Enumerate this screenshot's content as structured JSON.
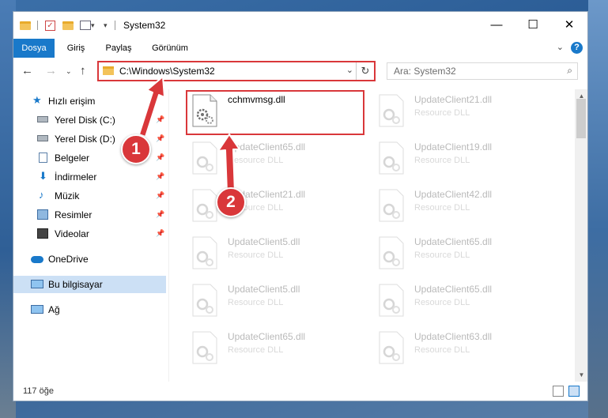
{
  "window": {
    "title": "System32"
  },
  "ribbon": {
    "tabs": [
      "Dosya",
      "Giriş",
      "Paylaş",
      "Görünüm"
    ]
  },
  "address": {
    "path": "C:\\Windows\\System32"
  },
  "search": {
    "placeholder": "Ara: System32"
  },
  "sidebar": {
    "quick_access": "Hızlı erişim",
    "items": [
      "Yerel Disk (C:)",
      "Yerel Disk (D:)",
      "Belgeler",
      "İndirmeler",
      "Müzik",
      "Resimler",
      "Videolar"
    ],
    "onedrive": "OneDrive",
    "this_pc": "Bu bilgisayar",
    "network": "Ağ"
  },
  "files": [
    {
      "name": "cchmvmsg.dll",
      "type": ""
    },
    {
      "name": "UpdateClient21.dll",
      "type": "Resource DLL"
    },
    {
      "name": "UpdateClient65.dll",
      "type": "Resource DLL"
    },
    {
      "name": "UpdateClient19.dll",
      "type": "Resource DLL"
    },
    {
      "name": "UpdateClient21.dll",
      "type": "Resource DLL"
    },
    {
      "name": "UpdateClient42.dll",
      "type": "Resource DLL"
    },
    {
      "name": "UpdateClient5.dll",
      "type": "Resource DLL"
    },
    {
      "name": "UpdateClient65.dll",
      "type": "Resource DLL"
    },
    {
      "name": "UpdateClient5.dll",
      "type": "Resource DLL"
    },
    {
      "name": "UpdateClient65.dll",
      "type": "Resource DLL"
    },
    {
      "name": "UpdateClient65.dll",
      "type": "Resource DLL"
    },
    {
      "name": "UpdateClient63.dll",
      "type": "Resource DLL"
    }
  ],
  "status": {
    "count": "117 öğe"
  },
  "callouts": [
    "1",
    "2"
  ],
  "colors": {
    "accent": "#1979ca",
    "highlight": "#d9373a"
  }
}
